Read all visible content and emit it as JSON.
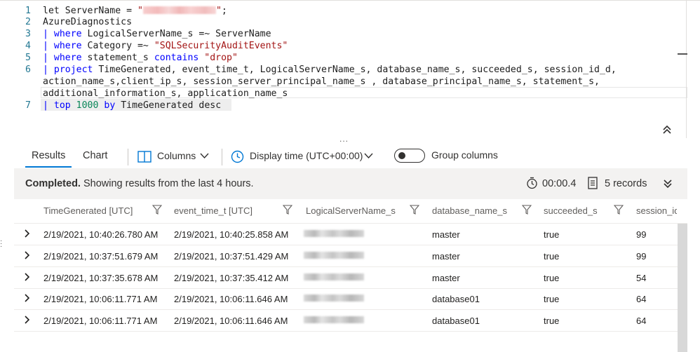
{
  "editor": {
    "lines": [
      {
        "n": "1",
        "parts": [
          {
            "t": "let ServerName = ",
            "c": ""
          },
          {
            "t": "\"",
            "c": "str"
          },
          {
            "t": "",
            "c": "blur"
          },
          {
            "t": "\"",
            "c": "str"
          },
          {
            "t": ";",
            "c": ""
          }
        ]
      },
      {
        "n": "2",
        "parts": [
          {
            "t": "AzureDiagnostics",
            "c": ""
          }
        ]
      },
      {
        "n": "3",
        "parts": [
          {
            "t": "| ",
            "c": "pipe"
          },
          {
            "t": "where",
            "c": "kw"
          },
          {
            "t": " LogicalServerName_s =~ ServerName",
            "c": ""
          }
        ]
      },
      {
        "n": "4",
        "parts": [
          {
            "t": "| ",
            "c": "pipe"
          },
          {
            "t": "where",
            "c": "kw"
          },
          {
            "t": " Category =~ ",
            "c": ""
          },
          {
            "t": "\"SQLSecurityAuditEvents\"",
            "c": "str"
          }
        ]
      },
      {
        "n": "5",
        "parts": [
          {
            "t": "| ",
            "c": "pipe"
          },
          {
            "t": "where",
            "c": "kw"
          },
          {
            "t": " statement_s ",
            "c": ""
          },
          {
            "t": "contains",
            "c": "kw"
          },
          {
            "t": " ",
            "c": ""
          },
          {
            "t": "\"drop\"",
            "c": "str"
          }
        ]
      },
      {
        "n": "6",
        "parts": [
          {
            "t": "| ",
            "c": "pipe"
          },
          {
            "t": "project",
            "c": "kw"
          },
          {
            "t": " TimeGenerated, event_time_t, LogicalServerName_s, database_name_s, succeeded_s, session_id_d,",
            "c": ""
          }
        ]
      },
      {
        "n": "",
        "parts": [
          {
            "t": "action_name_s,client_ip_s, session_server_principal_name_s , database_principal_name_s, statement_s,",
            "c": ""
          }
        ]
      },
      {
        "n": "",
        "parts": [
          {
            "t": "additional_information_s, application_name_s",
            "c": ""
          }
        ]
      },
      {
        "n": "7",
        "parts": [
          {
            "t": "| ",
            "c": "pipe"
          },
          {
            "t": "top",
            "c": "kw"
          },
          {
            "t": " ",
            "c": ""
          },
          {
            "t": "1000",
            "c": "num"
          },
          {
            "t": " ",
            "c": ""
          },
          {
            "t": "by",
            "c": "kw"
          },
          {
            "t": " TimeGenerated desc",
            "c": ""
          }
        ]
      }
    ],
    "collapse_handle": "..."
  },
  "toolbar": {
    "tab_results": "Results",
    "tab_chart": "Chart",
    "columns_label": "Columns",
    "display_time_label": "Display time (UTC+00:00)",
    "group_columns_label": "Group columns"
  },
  "status": {
    "completed": "Completed.",
    "message": " Showing results from the last 4 hours.",
    "duration": "00:00.4",
    "records": "5 records"
  },
  "table": {
    "headers": [
      "TimeGenerated [UTC]",
      "event_time_t [UTC]",
      "LogicalServerName_s",
      "database_name_s",
      "succeeded_s",
      "session_id_"
    ],
    "rows": [
      {
        "time_generated": "2/19/2021, 10:40:26.780 AM",
        "event_time": "2/19/2021, 10:40:25.858 AM",
        "server": "",
        "database": "master",
        "succeeded": "true",
        "session_id": "99"
      },
      {
        "time_generated": "2/19/2021, 10:37:51.679 AM",
        "event_time": "2/19/2021, 10:37:51.429 AM",
        "server": "",
        "database": "master",
        "succeeded": "true",
        "session_id": "99"
      },
      {
        "time_generated": "2/19/2021, 10:37:35.678 AM",
        "event_time": "2/19/2021, 10:37:35.412 AM",
        "server": "",
        "database": "master",
        "succeeded": "true",
        "session_id": "54"
      },
      {
        "time_generated": "2/19/2021, 10:06:11.771 AM",
        "event_time": "2/19/2021, 10:06:11.646 AM",
        "server": "",
        "database": "database01",
        "succeeded": "true",
        "session_id": "64"
      },
      {
        "time_generated": "2/19/2021, 10:06:11.771 AM",
        "event_time": "2/19/2021, 10:06:11.646 AM",
        "server": "",
        "database": "database01",
        "succeeded": "true",
        "session_id": "64"
      }
    ]
  },
  "colors": {
    "accent": "#0078d4",
    "keyword": "#0000ff",
    "string": "#a31515",
    "number": "#098658",
    "line_number": "#237893",
    "status_bar_bg": "#f3f2f1"
  },
  "icons": [
    "chevron-up-double-icon",
    "columns-icon",
    "chevron-down-icon",
    "clock-icon",
    "toggle-switch",
    "stopwatch-icon",
    "document-icon",
    "expand-chevron-icon",
    "filter-icon",
    "row-expand-chevron-icon"
  ]
}
